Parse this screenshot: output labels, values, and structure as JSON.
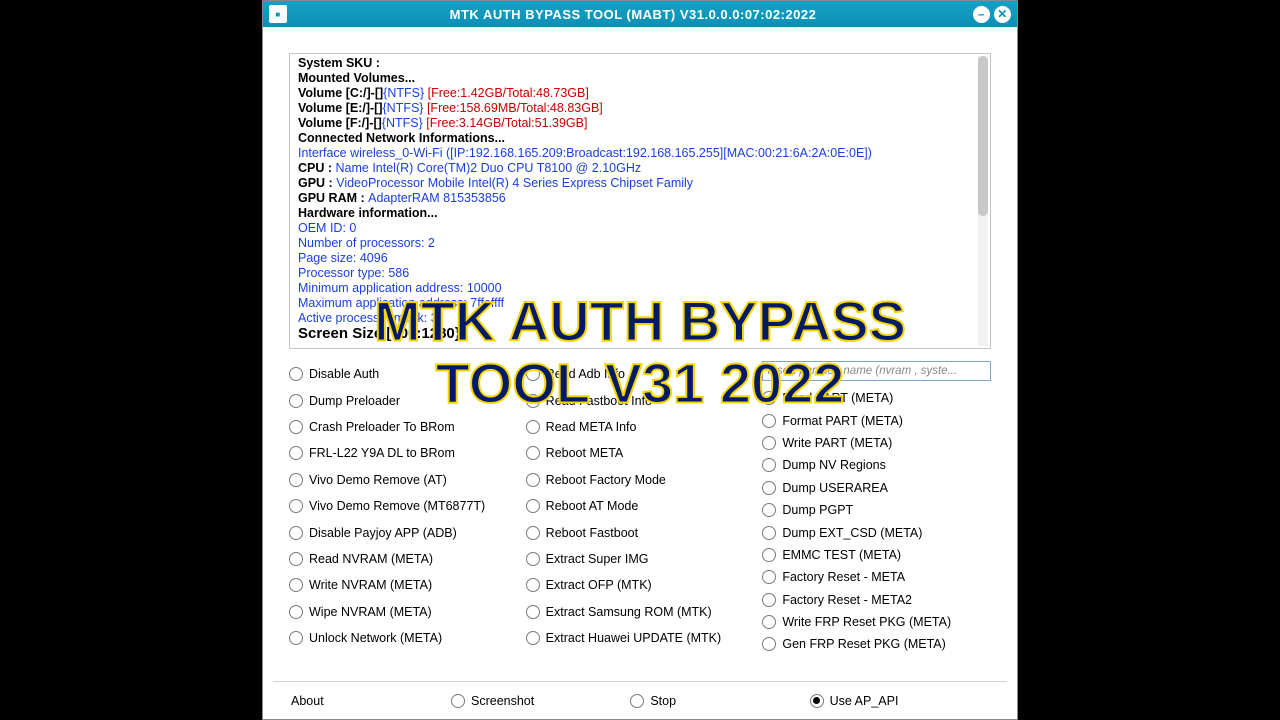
{
  "titlebar": {
    "title": "MTK AUTH BYPASS TOOL (MABT) V31.0.0.0:07:02:2022"
  },
  "log": {
    "l0": "System SKU :",
    "l1": "Mounted Volumes...",
    "l2a": "Volume [C:/]-[]",
    "l2b": "{NTFS}",
    "l2c": " [Free:1.42GB/Total:48.73GB]",
    "l3a": "Volume [E:/]-[]",
    "l3b": "{NTFS}",
    "l3c": " [Free:158.69MB/Total:48.83GB]",
    "l4a": "Volume [F:/]-[]",
    "l4b": "{NTFS}",
    "l4c": " [Free:3.14GB/Total:51.39GB]",
    "l5": "Connected Network Informations...",
    "l6": "Interface wireless_0-Wi-Fi ([IP:192.168.165.209:Broadcast:192.168.165.255][MAC:00:21:6A:2A:0E:0E])",
    "l7a": "CPU  : ",
    "l7b": "Name Intel(R) Core(TM)2 Duo CPU T8100 @ 2.10GHz",
    "l8a": "GPU  : ",
    "l8b": "VideoProcessor Mobile Intel(R) 4 Series Express Chipset Family",
    "l9a": "GPU RAM  : ",
    "l9b": "AdapterRAM 815353856",
    "l10": "Hardware information...",
    "l11": "OEM ID: 0",
    "l12": "Number of processors: 2",
    "l13": "Page size: 4096",
    "l14": "Processor type: 586",
    "l15": "Minimum application address: 10000",
    "l16": "Maximum application address: 7ffeffff",
    "l17": "Active processor mask: 3",
    "l18": "Screen Size [800:1280}"
  },
  "col1": [
    "Disable Auth",
    "Dump Preloader",
    "Crash Preloader To BRom",
    "FRL-L22 Y9A DL to BRom",
    "Vivo Demo Remove (AT)",
    "Vivo Demo Remove (MT6877T)",
    "Disable Payjoy APP (ADB)",
    "Read NVRAM (META)",
    "Write NVRAM (META)",
    "Wipe NVRAM (META)",
    "Unlock Network (META)"
  ],
  "col2": [
    "Read Adb Info",
    "Read Fastboot Info",
    "Read META Info",
    "Reboot META",
    "Reboot Factory Mode",
    "Reboot AT Mode",
    "Reboot Fastboot",
    "Extract Super IMG",
    "Extract OFP (MTK)",
    "Extract Samsung ROM (MTK)",
    "Extract Huawei UPDATE (MTK)"
  ],
  "partition_placeholder": "Insert partition name (nvram , syste...",
  "col3": [
    "Read PART (META)",
    "Format PART (META)",
    "Write PART (META)",
    "Dump NV Regions",
    "Dump USERAREA",
    "Dump PGPT",
    "Dump  EXT_CSD (META)",
    "EMMC TEST (META)",
    "Factory Reset - META",
    "Factory Reset - META2",
    "Write FRP Reset PKG (META)",
    "Gen FRP Reset PKG (META)"
  ],
  "footer": {
    "about": "About",
    "screenshot": "Screenshot",
    "stop": "Stop",
    "use_api": "Use AP_API"
  },
  "overlay": {
    "line1": "MTK AUTH BYPASS",
    "line2": "TOOL V31 2022"
  }
}
